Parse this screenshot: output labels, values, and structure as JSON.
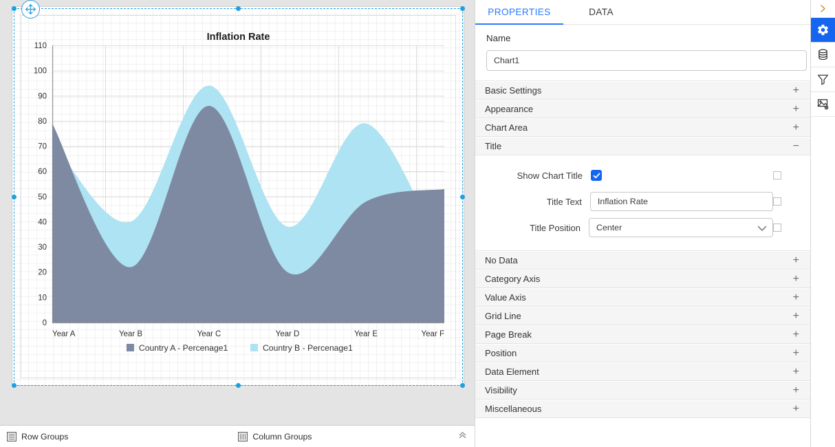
{
  "design": {
    "move_handle_icon": "move-cross-icon",
    "report_item_name": "Chart1"
  },
  "chart_data": {
    "type": "area",
    "title": "Inflation Rate",
    "xlabel": "",
    "ylabel": "",
    "categories": [
      "Year A",
      "Year B",
      "Year C",
      "Year D",
      "Year E",
      "Year F"
    ],
    "ylim": [
      0,
      110
    ],
    "ytick_step": 10,
    "yticks": [
      0,
      10,
      20,
      30,
      40,
      50,
      60,
      70,
      80,
      90,
      100,
      110
    ],
    "grid": true,
    "legend_position": "bottom",
    "series": [
      {
        "name": "Country A - Percenage1",
        "color": "#7e8aa2",
        "values": [
          79,
          22,
          86,
          20,
          48,
          53
        ]
      },
      {
        "name": "Country B - Percenage1",
        "color": "#ade3f2",
        "values": [
          72,
          40,
          94,
          38,
          79,
          25
        ]
      }
    ]
  },
  "groups_bar": {
    "row_groups_label": "Row Groups",
    "row_groups_icon": "row-groups-icon",
    "column_groups_label": "Column Groups",
    "column_groups_icon": "column-groups-icon",
    "collapse_icon": "chevron-double-up-icon"
  },
  "properties_panel": {
    "tabs": [
      {
        "label": "PROPERTIES",
        "active": true
      },
      {
        "label": "DATA",
        "active": false
      }
    ],
    "name": {
      "label": "Name",
      "value": "Chart1",
      "placeholder": "Name"
    },
    "sections": [
      {
        "label": "Basic Settings",
        "sign": "+",
        "expanded": false
      },
      {
        "label": "Appearance",
        "sign": "+",
        "expanded": false
      },
      {
        "label": "Chart Area",
        "sign": "+",
        "expanded": false
      },
      {
        "label": "Title",
        "sign": "−",
        "expanded": true
      },
      {
        "label": "No Data",
        "sign": "+",
        "expanded": false
      },
      {
        "label": "Category Axis",
        "sign": "+",
        "expanded": false
      },
      {
        "label": "Value Axis",
        "sign": "+",
        "expanded": false
      },
      {
        "label": "Grid Line",
        "sign": "+",
        "expanded": false
      },
      {
        "label": "Page Break",
        "sign": "+",
        "expanded": false
      },
      {
        "label": "Position",
        "sign": "+",
        "expanded": false
      },
      {
        "label": "Data Element",
        "sign": "+",
        "expanded": false
      },
      {
        "label": "Visibility",
        "sign": "+",
        "expanded": false
      },
      {
        "label": "Miscellaneous",
        "sign": "+",
        "expanded": false
      }
    ],
    "title_section": {
      "show_chart_title_label": "Show Chart Title",
      "show_chart_title_checked": true,
      "title_text_label": "Title Text",
      "title_text_value": "Inflation Rate",
      "title_position_label": "Title Position",
      "title_position_value": "Center"
    }
  },
  "icon_rail": {
    "collapse_icon": "chevron-right-icon",
    "buttons": [
      {
        "icon": "gear-icon",
        "active": true
      },
      {
        "icon": "database-icon",
        "active": false
      },
      {
        "icon": "filter-funnel-icon",
        "active": false
      },
      {
        "icon": "image-settings-icon",
        "active": false
      }
    ]
  },
  "colors": {
    "accent": "#2979ff",
    "rail_active": "#1565f0",
    "selection": "#1ea0e0",
    "series_a": "#7e8aa2",
    "series_b": "#ade3f2",
    "surface": "#e4e4e4"
  }
}
